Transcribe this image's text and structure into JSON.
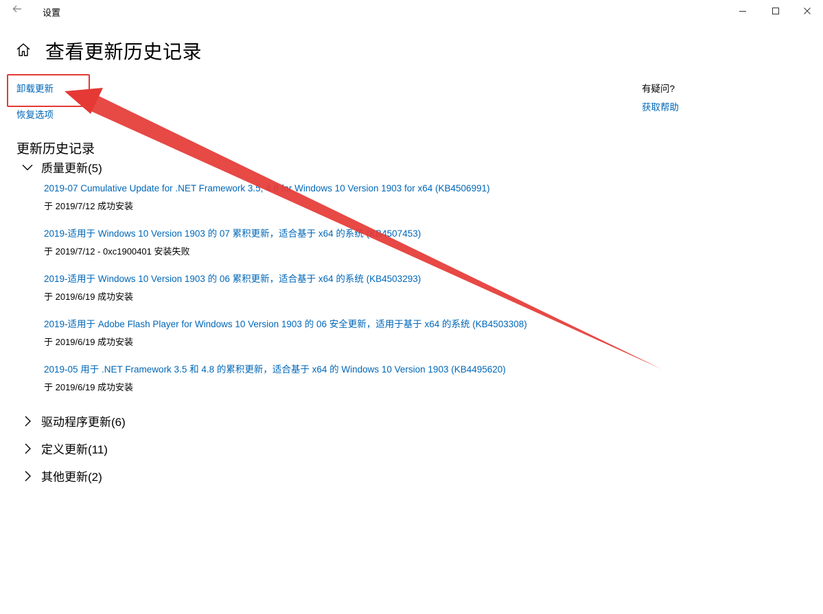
{
  "window": {
    "app_title": "设置"
  },
  "page": {
    "title": "查看更新历史记录",
    "uninstall_link": "卸载更新",
    "recovery_link": "恢复选项"
  },
  "help": {
    "title": "有疑问?",
    "link": "获取帮助"
  },
  "history": {
    "heading": "更新历史记录",
    "groups": [
      {
        "label": "质量更新(5)",
        "expanded": true
      },
      {
        "label": "驱动程序更新(6)",
        "expanded": false
      },
      {
        "label": "定义更新(11)",
        "expanded": false
      },
      {
        "label": "其他更新(2)",
        "expanded": false
      }
    ],
    "quality_updates": [
      {
        "title": "2019-07 Cumulative Update for .NET Framework 3.5, 4.8 for Windows 10 Version 1903 for x64 (KB4506991)",
        "status": "于 2019/7/12 成功安装"
      },
      {
        "title": "2019-适用于 Windows 10 Version 1903 的 07 累积更新，适合基于 x64 的系统 (KB4507453)",
        "status": "于 2019/7/12 - 0xc1900401 安装失败"
      },
      {
        "title": "2019-适用于 Windows 10 Version 1903 的 06 累积更新，适合基于 x64 的系统 (KB4503293)",
        "status": "于 2019/6/19 成功安装"
      },
      {
        "title": "2019-适用于 Adobe Flash Player for Windows 10 Version 1903 的 06 安全更新，适用于基于 x64 的系统 (KB4503308)",
        "status": "于 2019/6/19 成功安装"
      },
      {
        "title": "2019-05 用于 .NET Framework 3.5 和 4.8 的累积更新，适合基于 x64 的 Windows 10 Version 1903 (KB4495620)",
        "status": "于 2019/6/19 成功安装"
      }
    ]
  },
  "colors": {
    "link": "#0067b8",
    "annotation": "#e53935"
  },
  "icons": [
    "back-arrow-icon",
    "minimize-icon",
    "maximize-icon",
    "close-icon",
    "home-icon",
    "chevron-down-icon",
    "chevron-right-icon"
  ]
}
